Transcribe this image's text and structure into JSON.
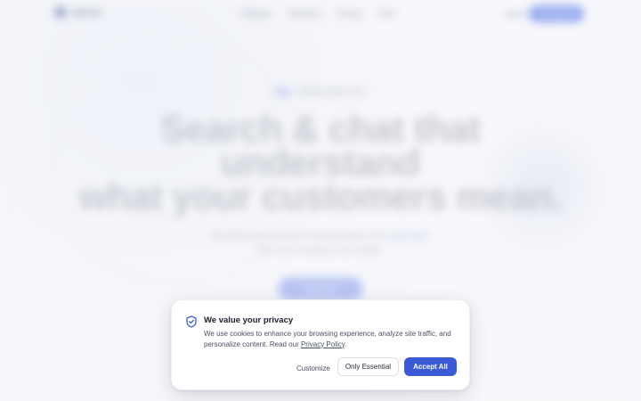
{
  "background": {
    "nav": {
      "logo_text": "ragchat",
      "links": [
        "Features",
        "Solutions",
        "Pricing",
        "Docs"
      ],
      "login": "Log in",
      "cta": "Get started"
    },
    "pill": {
      "tag": "New",
      "text": "Semantic search + chat"
    },
    "hero": {
      "line1": "Search & chat that",
      "line2": "understand",
      "line3": "what your customers mean."
    },
    "sub": {
      "line1_a": "Semantic search and AI chat that learns from ",
      "line1_accent": "your docs",
      "line2": "Set it up in minutes, not months."
    },
    "hero_button": "Start free"
  },
  "cookie": {
    "title": "We value your privacy",
    "text_before": "We use cookies to enhance your browsing experience, analyze site traffic, and personalize content. Read our ",
    "link": "Privacy Policy",
    "text_after": ".",
    "customize": "Customize",
    "only_essential": "Only Essential",
    "accept_all": "Accept All",
    "icon": "shield-check-icon",
    "accent_color": "#3b5bd6"
  }
}
